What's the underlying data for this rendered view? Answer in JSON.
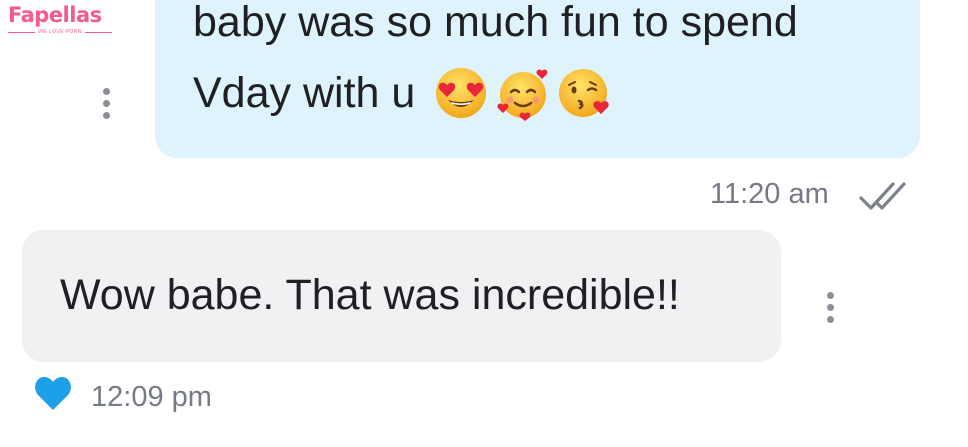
{
  "watermark": {
    "brand": "Fapellas",
    "tagline": "WE LOVE PORN",
    "color": "#f35b8a"
  },
  "messages": [
    {
      "direction": "outgoing",
      "lines": [
        "baby was so much fun to spend",
        "Vday with u"
      ],
      "emojis": [
        "heart-eyes-emoji",
        "smiling-face-with-hearts-emoji",
        "face-blowing-kiss-emoji"
      ],
      "time": "11:20 am",
      "status_icon": "double-check-icon",
      "bubble_color": "#dff3fc"
    },
    {
      "direction": "incoming",
      "text": "Wow babe. That was incredible!!",
      "time": "12:09 pm",
      "reaction_icon": "heart-icon",
      "reaction_color": "#1ea0e8",
      "bubble_color": "#f0f1f3"
    }
  ],
  "icons": {
    "more": "kebab-menu-icon"
  }
}
